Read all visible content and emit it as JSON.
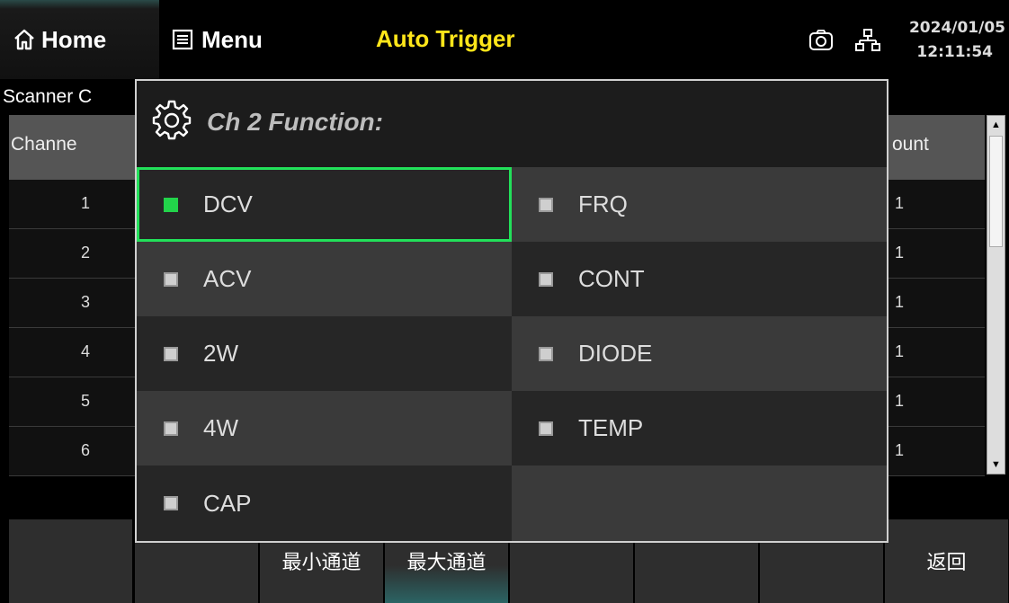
{
  "topbar": {
    "home_label": "Home",
    "menu_label": "Menu",
    "trigger_mode": "Auto Trigger",
    "date": "2024/01/05",
    "time": "12:11:54",
    "icons": [
      "home-icon",
      "menu-icon",
      "camera-icon",
      "network-icon"
    ],
    "trigger_color": "#ffe61a"
  },
  "background": {
    "scanner_title": "Scanner C",
    "table_headers": [
      "Channe",
      "ount"
    ],
    "rows": [
      {
        "index": "1",
        "count": "1"
      },
      {
        "index": "2",
        "count": "1"
      },
      {
        "index": "3",
        "count": "1"
      },
      {
        "index": "4",
        "count": "1"
      },
      {
        "index": "5",
        "count": "1"
      },
      {
        "index": "6",
        "count": "1"
      }
    ]
  },
  "dialog": {
    "title": "Ch 2 Function:",
    "icon": "gear-icon",
    "selected": "DCV",
    "selected_color": "#22e05a",
    "options": [
      {
        "label": "DCV"
      },
      {
        "label": "FRQ"
      },
      {
        "label": "ACV"
      },
      {
        "label": "CONT"
      },
      {
        "label": "2W"
      },
      {
        "label": "DIODE"
      },
      {
        "label": "4W"
      },
      {
        "label": "TEMP"
      },
      {
        "label": "CAP"
      }
    ]
  },
  "softkeys": [
    "",
    "",
    "最小通道",
    "最大通道",
    "",
    "",
    "",
    "返回"
  ]
}
